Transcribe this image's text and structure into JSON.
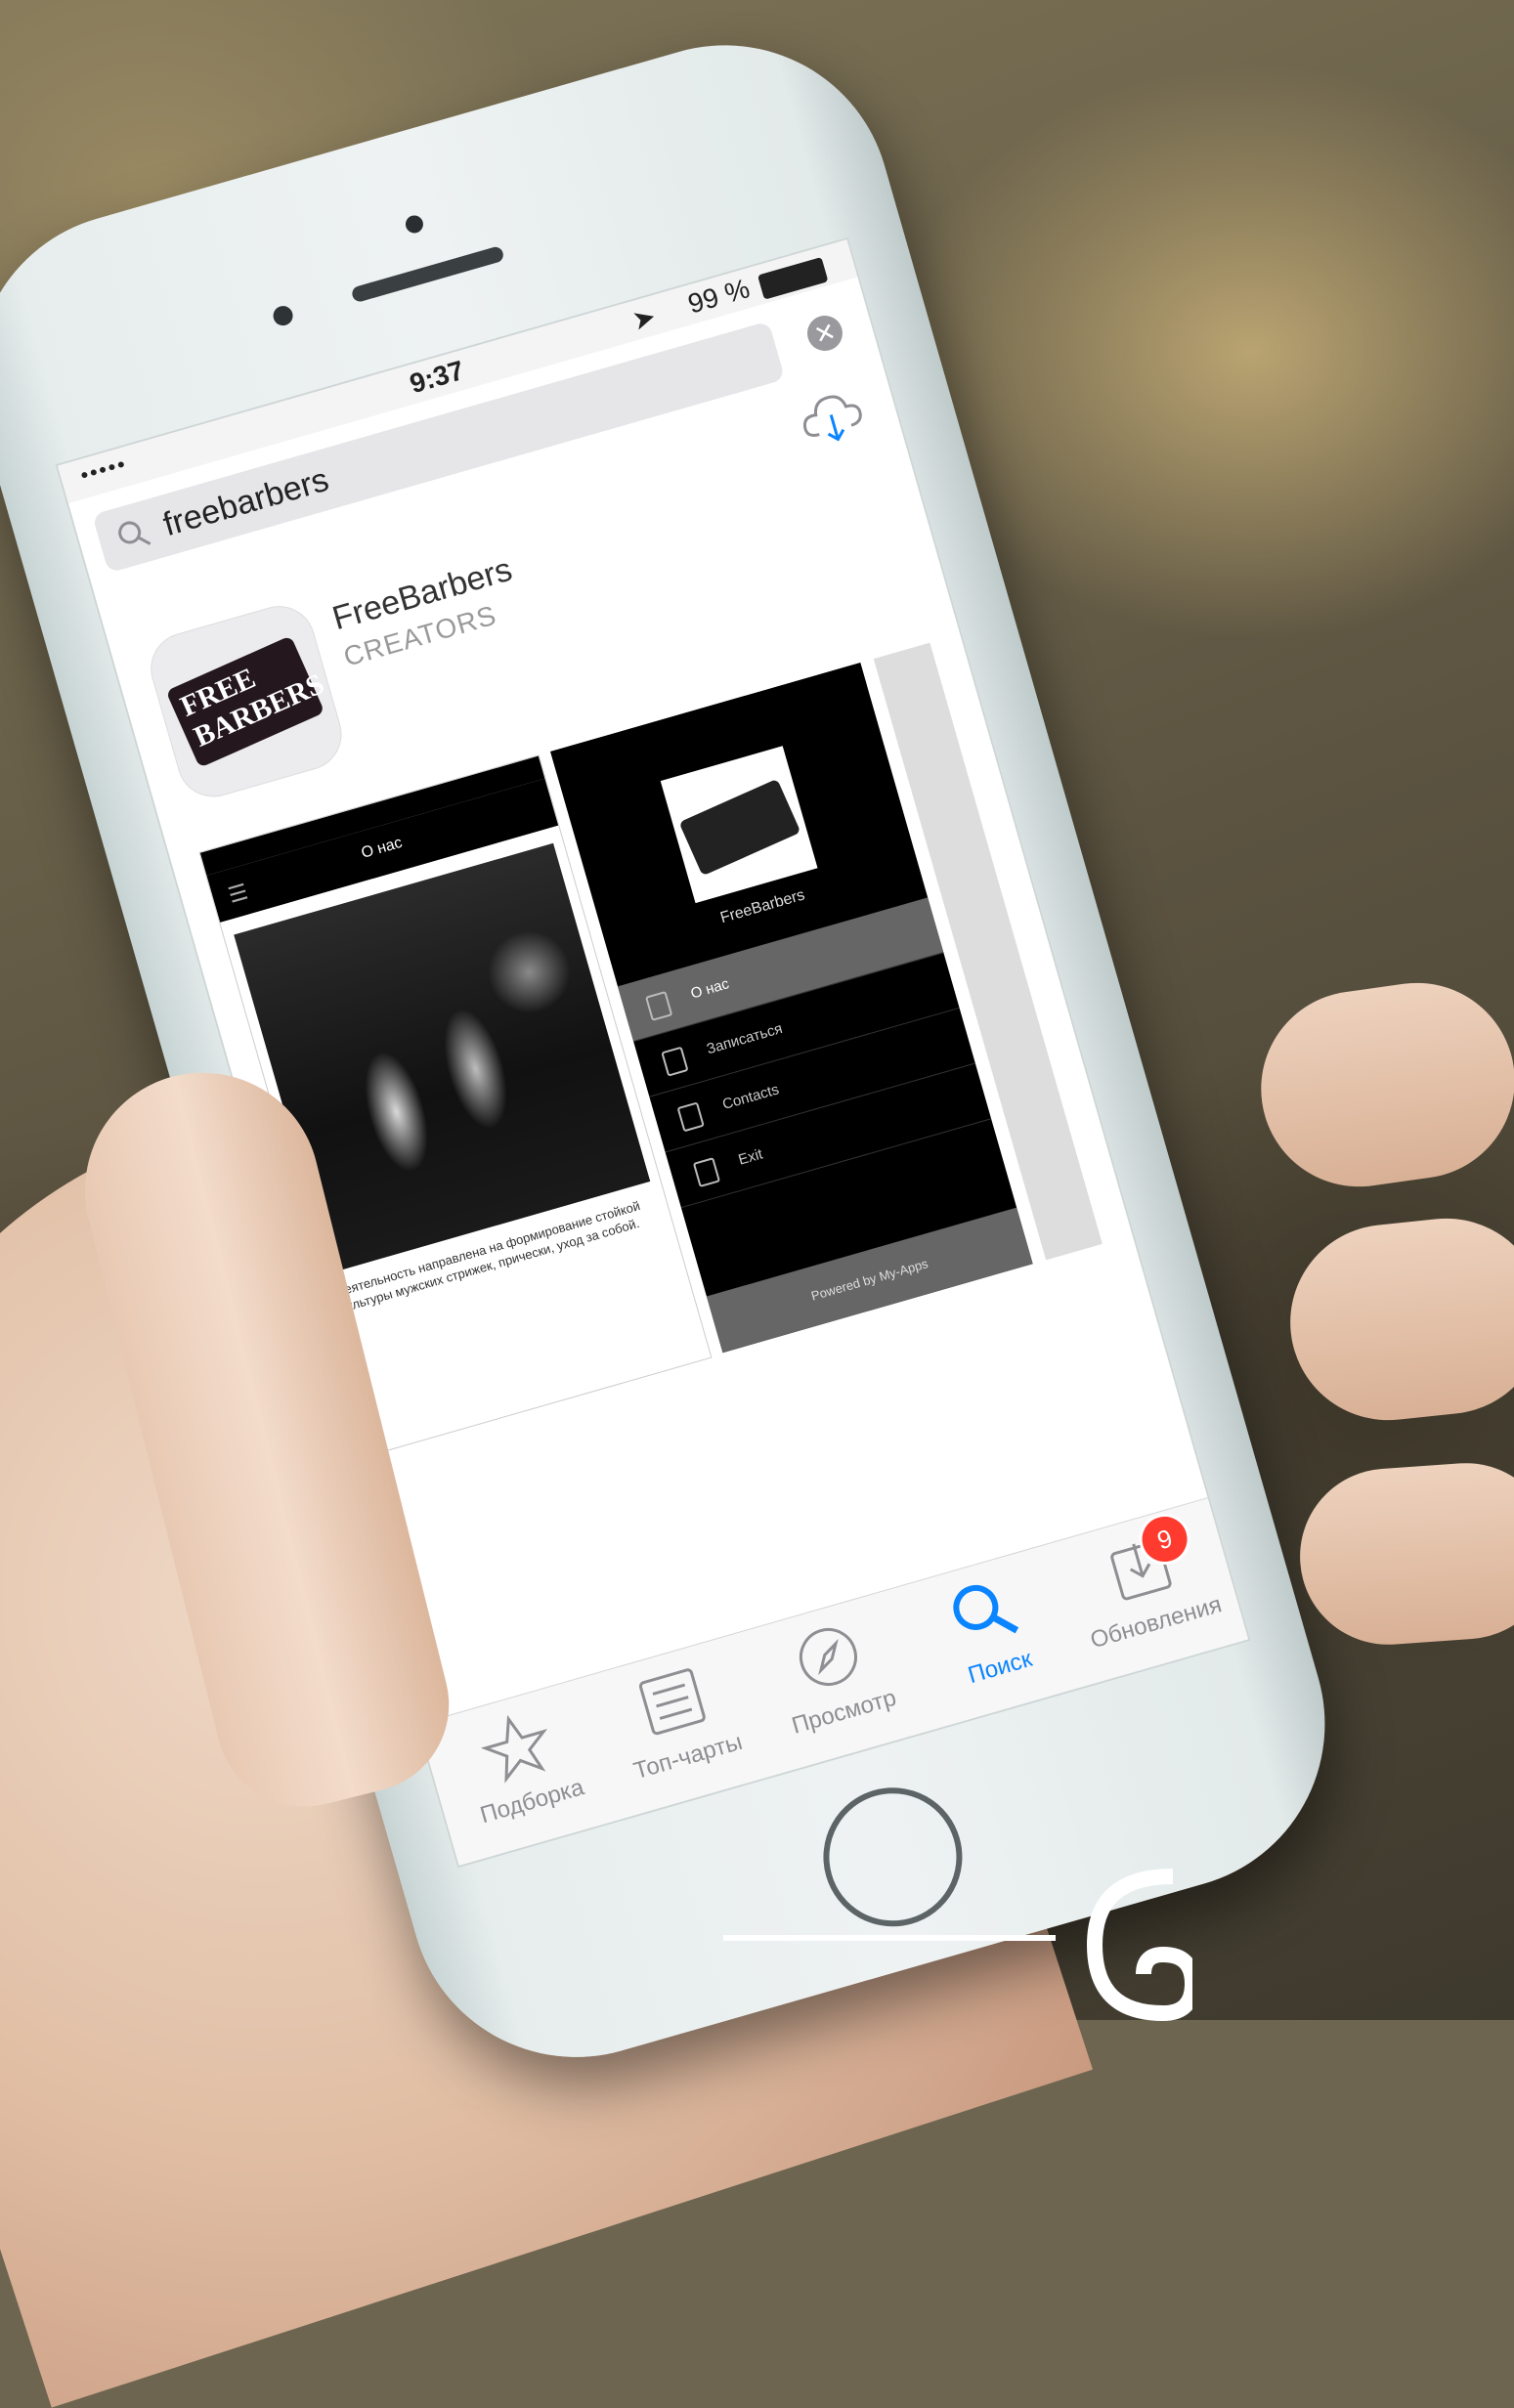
{
  "status_bar": {
    "signal": "•••••",
    "time": "9:37",
    "location_glyph": "➤",
    "battery": "99 %"
  },
  "search": {
    "query": "freebarbers",
    "clear_glyph": "✕"
  },
  "app": {
    "name": "FreeBarbers",
    "developer": "CREATORS",
    "icon_text": "FREE BARBERS"
  },
  "screenshot1": {
    "nav_title": "О нас",
    "caption": "Деятельность направлена на формирование стойкой культуры мужских стрижек, прически, уход за собой."
  },
  "screenshot2": {
    "brand": "FreeBarbers",
    "menu": [
      "О нас",
      "Записаться",
      "Contacts",
      "Exit"
    ],
    "footer": "Powered by My-Apps"
  },
  "tabbar": {
    "items": [
      {
        "label": "Подборка",
        "icon": "star-icon"
      },
      {
        "label": "Топ-чарты",
        "icon": "list-icon"
      },
      {
        "label": "Просмотр",
        "icon": "compass-icon"
      },
      {
        "label": "Поиск",
        "icon": "search-icon"
      },
      {
        "label": "Обновления",
        "icon": "download-icon"
      }
    ],
    "active_index": 3,
    "updates_badge": "9"
  },
  "colors": {
    "accent": "#0a84ff",
    "badge": "#ff3b30"
  }
}
